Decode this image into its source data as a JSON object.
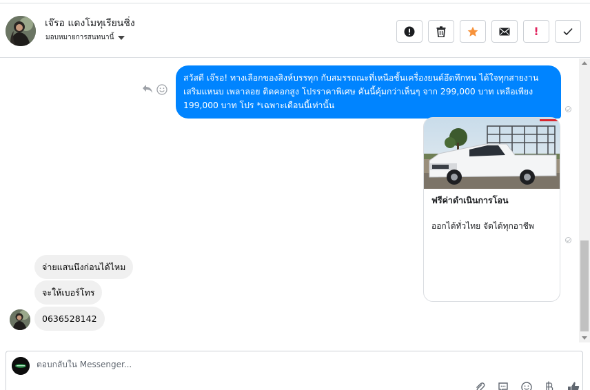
{
  "header": {
    "contact_name": "เจ๊รอ แดงโมทุเรียนชิ่ง",
    "assign_label": "มอบหมายการสนทนานี้"
  },
  "actions": {
    "icons": [
      "spam-icon",
      "trash-icon",
      "star-icon",
      "envelope-icon",
      "exclamation-icon",
      "checkmark-icon"
    ],
    "star_color": "#f7923b",
    "flag_color": "#e0245e"
  },
  "thread": {
    "outgoing_message": "สวัสดี เจ๊รอ! ทางเลือกของสิงห์บรรทุก กับสมรรถณะที่เหนือชั้นเครื่องยนต์อึดทึกทน ได้ใจทุกสายงาน เสริมแหนบ เพลาลอย ติดคอกสูง โปรราคาพิเศษ คันนี้คุ้มกว่าเห็นๆ จาก 299,000 บาท เหลือเพียง 199,000 บาท โปร *เฉพาะเดือนนี้เท่านั้น",
    "card": {
      "title": "ฟรีค่าดำเนินการโอน",
      "subtitle": "ออกได้ทั่วไทย จัดได้ทุกอาชีพ"
    },
    "incoming_messages": [
      "จ่ายแสนนึงก่อนได้ไหม",
      "จะให้เบอร์โทร",
      "0636528142"
    ],
    "outgoing_bubble_color": "#0084ff",
    "incoming_bubble_color": "#f0f0f0"
  },
  "composer": {
    "placeholder": "ตอบกลับใน Messenger...",
    "tools": [
      "paperclip-icon",
      "saved-reply-icon",
      "emoji-icon",
      "baht-icon",
      "thumbs-up-icon"
    ]
  }
}
